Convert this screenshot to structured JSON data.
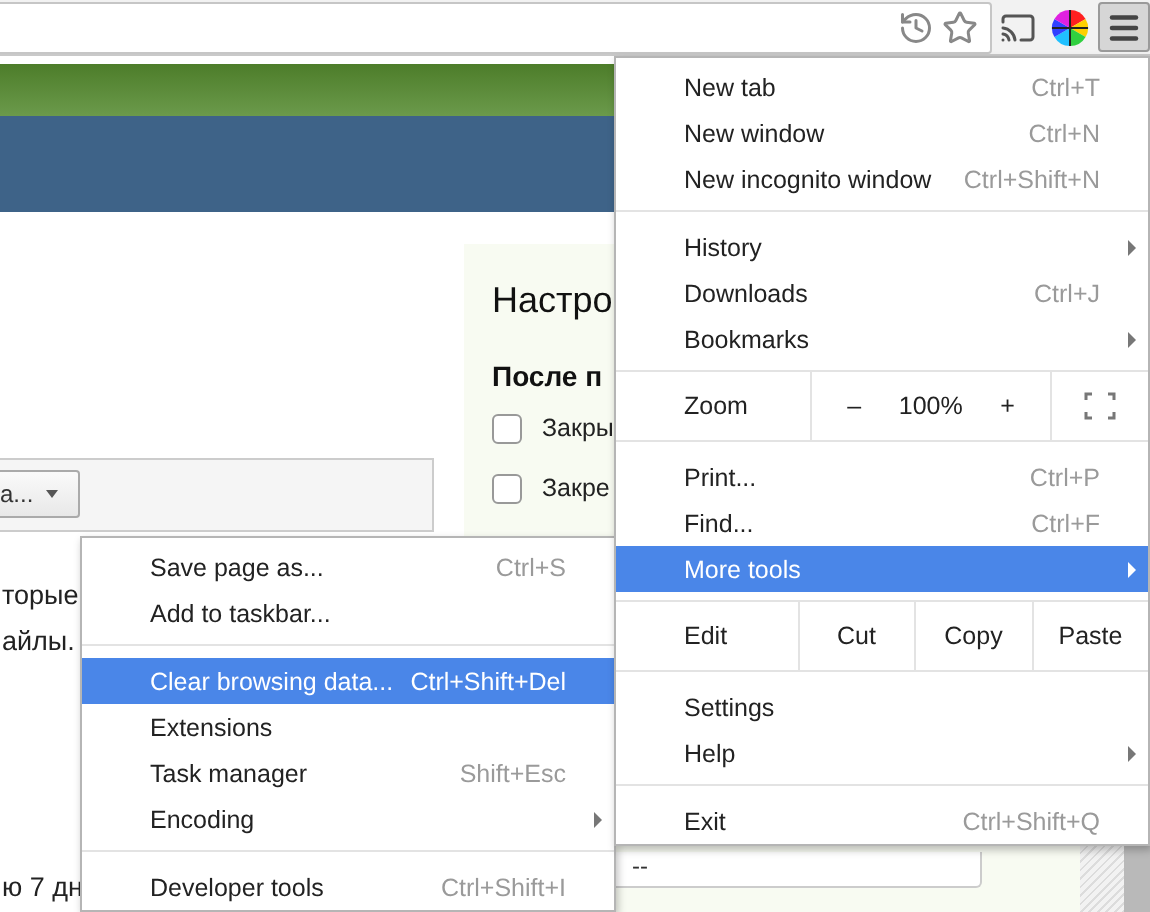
{
  "toolbar": {
    "menu_button_pressed": true
  },
  "page": {
    "dropdown": "а...",
    "texts": [
      "торые",
      "айлы.",
      "ю 7 дн"
    ],
    "panel": {
      "title": "Настро",
      "section": "После п",
      "checkboxes": [
        {
          "label": "Закры",
          "checked": false
        },
        {
          "label": "Закре",
          "checked": false
        }
      ],
      "field_value": "--"
    }
  },
  "main_menu": {
    "groups": [
      [
        {
          "kind": "item",
          "label": "New tab",
          "shortcut": "Ctrl+T",
          "has_submenu": false,
          "selected": false
        },
        {
          "kind": "item",
          "label": "New window",
          "shortcut": "Ctrl+N",
          "has_submenu": false,
          "selected": false
        },
        {
          "kind": "item",
          "label": "New incognito window",
          "shortcut": "Ctrl+Shift+N",
          "has_submenu": false,
          "selected": false
        }
      ],
      [
        {
          "kind": "item",
          "label": "History",
          "has_submenu": true,
          "selected": false
        },
        {
          "kind": "item",
          "label": "Downloads",
          "shortcut": "Ctrl+J",
          "has_submenu": false,
          "selected": false
        },
        {
          "kind": "item",
          "label": "Bookmarks",
          "has_submenu": true,
          "selected": false
        }
      ],
      [
        {
          "kind": "zoom",
          "label": "Zoom",
          "minus": "–",
          "value": "100%",
          "plus": "+"
        }
      ],
      [
        {
          "kind": "item",
          "label": "Print...",
          "shortcut": "Ctrl+P",
          "has_submenu": false,
          "selected": false
        },
        {
          "kind": "item",
          "label": "Find...",
          "shortcut": "Ctrl+F",
          "has_submenu": false,
          "selected": false
        },
        {
          "kind": "item",
          "label": "More tools",
          "has_submenu": true,
          "selected": true
        }
      ],
      [
        {
          "kind": "edit",
          "label": "Edit",
          "buttons": [
            "Cut",
            "Copy",
            "Paste"
          ]
        }
      ],
      [
        {
          "kind": "item",
          "label": "Settings",
          "has_submenu": false,
          "selected": false
        },
        {
          "kind": "item",
          "label": "Help",
          "has_submenu": true,
          "selected": false
        }
      ],
      [
        {
          "kind": "item",
          "label": "Exit",
          "shortcut": "Ctrl+Shift+Q",
          "has_submenu": false,
          "selected": false
        }
      ]
    ]
  },
  "submenu": {
    "groups": [
      [
        {
          "kind": "item",
          "label": "Save page as...",
          "shortcut": "Ctrl+S",
          "has_submenu": false,
          "selected": false
        },
        {
          "kind": "item",
          "label": "Add to taskbar...",
          "has_submenu": false,
          "selected": false
        }
      ],
      [
        {
          "kind": "item",
          "label": "Clear browsing data...",
          "shortcut": "Ctrl+Shift+Del",
          "has_submenu": false,
          "selected": true
        },
        {
          "kind": "item",
          "label": "Extensions",
          "has_submenu": false,
          "selected": false
        },
        {
          "kind": "item",
          "label": "Task manager",
          "shortcut": "Shift+Esc",
          "has_submenu": false,
          "selected": false
        },
        {
          "kind": "item",
          "label": "Encoding",
          "has_submenu": true,
          "selected": false
        }
      ],
      [
        {
          "kind": "item",
          "label": "Developer tools",
          "shortcut": "Ctrl+Shift+I",
          "has_submenu": false,
          "selected": false
        }
      ]
    ]
  }
}
